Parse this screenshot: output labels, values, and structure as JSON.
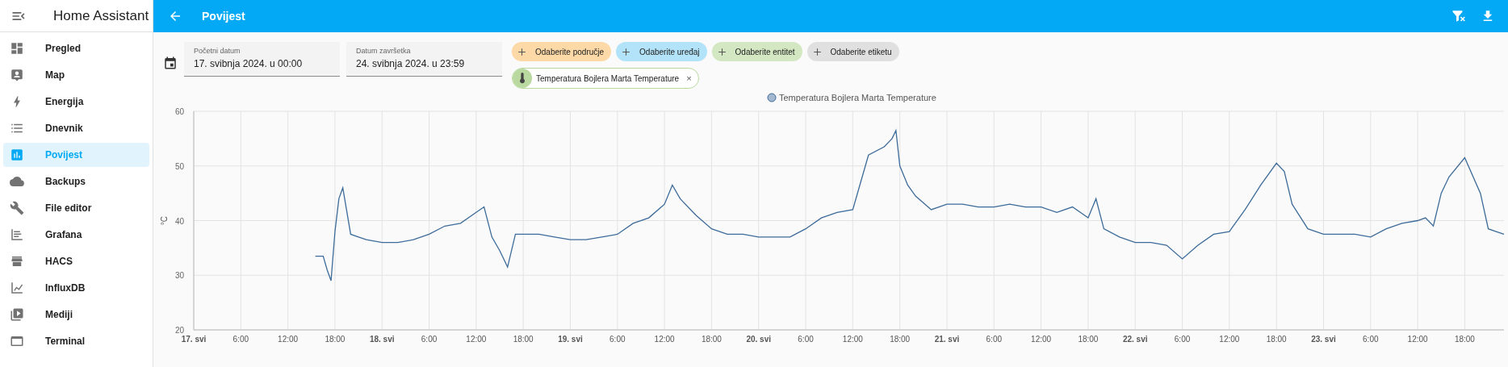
{
  "sidebar": {
    "title": "Home Assistant",
    "items": [
      {
        "label": "Pregled",
        "selected": false
      },
      {
        "label": "Map",
        "selected": false
      },
      {
        "label": "Energija",
        "selected": false
      },
      {
        "label": "Dnevnik",
        "selected": false
      },
      {
        "label": "Povijest",
        "selected": true
      },
      {
        "label": "Backups",
        "selected": false
      },
      {
        "label": "File editor",
        "selected": false
      },
      {
        "label": "Grafana",
        "selected": false
      },
      {
        "label": "HACS",
        "selected": false
      },
      {
        "label": "InfluxDB",
        "selected": false
      },
      {
        "label": "Mediji",
        "selected": false
      },
      {
        "label": "Terminal",
        "selected": false
      }
    ]
  },
  "toolbar": {
    "title": "Povijest"
  },
  "date_range": {
    "start": {
      "label": "Početni datum",
      "value": "17. svibnja 2024. u 00:00"
    },
    "end": {
      "label": "Datum završetka",
      "value": "24. svibnja 2024. u 23:59"
    }
  },
  "pickers": [
    {
      "label": "Odaberite područje",
      "color": "#fcd9a6"
    },
    {
      "label": "Odaberite uređaj",
      "color": "#b3e3f8"
    },
    {
      "label": "Odaberite entitet",
      "color": "#d3e8c2"
    },
    {
      "label": "Odaberite etiketu",
      "color": "#e0e0e0"
    }
  ],
  "selected_entities": [
    {
      "label": "Temperatura Bojlera Marta Temperature",
      "close": "×"
    }
  ],
  "chart": {
    "chart_data": {
      "type": "line",
      "grid": true,
      "ylabel": "°C",
      "xlim": [
        "2024-05-17 00:00",
        "2024-05-23 23:00"
      ],
      "ylim": [
        20,
        60
      ],
      "yticks": [
        20,
        30,
        40,
        50,
        60
      ],
      "xticks": [
        {
          "value": "2024-05-17 00:00",
          "label": "17. svi"
        },
        {
          "value": "2024-05-17 06:00",
          "label": "6:00"
        },
        {
          "value": "2024-05-17 12:00",
          "label": "12:00"
        },
        {
          "value": "2024-05-17 18:00",
          "label": "18:00"
        },
        {
          "value": "2024-05-18 00:00",
          "label": "18. svi"
        },
        {
          "value": "2024-05-18 06:00",
          "label": "6:00"
        },
        {
          "value": "2024-05-18 12:00",
          "label": "12:00"
        },
        {
          "value": "2024-05-18 18:00",
          "label": "18:00"
        },
        {
          "value": "2024-05-19 00:00",
          "label": "19. svi"
        },
        {
          "value": "2024-05-19 06:00",
          "label": "6:00"
        },
        {
          "value": "2024-05-19 12:00",
          "label": "12:00"
        },
        {
          "value": "2024-05-19 18:00",
          "label": "18:00"
        },
        {
          "value": "2024-05-20 00:00",
          "label": "20. svi"
        },
        {
          "value": "2024-05-20 06:00",
          "label": "6:00"
        },
        {
          "value": "2024-05-20 12:00",
          "label": "12:00"
        },
        {
          "value": "2024-05-20 18:00",
          "label": "18:00"
        },
        {
          "value": "2024-05-21 00:00",
          "label": "21. svi"
        },
        {
          "value": "2024-05-21 06:00",
          "label": "6:00"
        },
        {
          "value": "2024-05-21 12:00",
          "label": "12:00"
        },
        {
          "value": "2024-05-21 18:00",
          "label": "18:00"
        },
        {
          "value": "2024-05-22 00:00",
          "label": "22. svi"
        },
        {
          "value": "2024-05-22 06:00",
          "label": "6:00"
        },
        {
          "value": "2024-05-22 12:00",
          "label": "12:00"
        },
        {
          "value": "2024-05-22 18:00",
          "label": "18:00"
        },
        {
          "value": "2024-05-23 00:00",
          "label": "23. svi"
        },
        {
          "value": "2024-05-23 06:00",
          "label": "6:00"
        },
        {
          "value": "2024-05-23 12:00",
          "label": "12:00"
        },
        {
          "value": "2024-05-23 18:00",
          "label": "18:00"
        }
      ],
      "x": [
        "2024-05-17 15:30",
        "2024-05-17 16:30",
        "2024-05-17 17:00",
        "2024-05-17 17:30",
        "2024-05-17 18:00",
        "2024-05-17 18:30",
        "2024-05-17 19:00",
        "2024-05-17 20:00",
        "2024-05-17 21:00",
        "2024-05-17 22:00",
        "2024-05-18 00:00",
        "2024-05-18 02:00",
        "2024-05-18 04:00",
        "2024-05-18 06:00",
        "2024-05-18 08:00",
        "2024-05-18 10:00",
        "2024-05-18 12:00",
        "2024-05-18 13:00",
        "2024-05-18 14:00",
        "2024-05-18 15:00",
        "2024-05-18 16:00",
        "2024-05-18 17:00",
        "2024-05-18 18:00",
        "2024-05-18 20:00",
        "2024-05-18 22:00",
        "2024-05-19 00:00",
        "2024-05-19 02:00",
        "2024-05-19 04:00",
        "2024-05-19 06:00",
        "2024-05-19 08:00",
        "2024-05-19 10:00",
        "2024-05-19 12:00",
        "2024-05-19 13:00",
        "2024-05-19 14:00",
        "2024-05-19 16:00",
        "2024-05-19 18:00",
        "2024-05-19 20:00",
        "2024-05-19 22:00",
        "2024-05-20 00:00",
        "2024-05-20 02:00",
        "2024-05-20 04:00",
        "2024-05-20 06:00",
        "2024-05-20 08:00",
        "2024-05-20 10:00",
        "2024-05-20 12:00",
        "2024-05-20 14:00",
        "2024-05-20 16:00",
        "2024-05-20 17:00",
        "2024-05-20 17:30",
        "2024-05-20 18:00",
        "2024-05-20 19:00",
        "2024-05-20 20:00",
        "2024-05-20 22:00",
        "2024-05-21 00:00",
        "2024-05-21 02:00",
        "2024-05-21 04:00",
        "2024-05-21 06:00",
        "2024-05-21 08:00",
        "2024-05-21 10:00",
        "2024-05-21 12:00",
        "2024-05-21 14:00",
        "2024-05-21 16:00",
        "2024-05-21 18:00",
        "2024-05-21 19:00",
        "2024-05-21 20:00",
        "2024-05-21 22:00",
        "2024-05-22 00:00",
        "2024-05-22 02:00",
        "2024-05-22 04:00",
        "2024-05-22 06:00",
        "2024-05-22 08:00",
        "2024-05-22 10:00",
        "2024-05-22 12:00",
        "2024-05-22 14:00",
        "2024-05-22 16:00",
        "2024-05-22 18:00",
        "2024-05-22 19:00",
        "2024-05-22 20:00",
        "2024-05-22 22:00",
        "2024-05-23 00:00",
        "2024-05-23 02:00",
        "2024-05-23 04:00",
        "2024-05-23 06:00",
        "2024-05-23 08:00",
        "2024-05-23 10:00",
        "2024-05-23 12:00",
        "2024-05-23 13:00",
        "2024-05-23 14:00",
        "2024-05-23 15:00",
        "2024-05-23 16:00",
        "2024-05-23 18:00",
        "2024-05-23 20:00",
        "2024-05-23 21:00",
        "2024-05-23 22:00",
        "2024-05-23 23:00"
      ],
      "series": [
        {
          "name": "Temperatura Bojlera Marta Temperature",
          "color": "#3d6b99",
          "values": [
            33.5,
            33.5,
            31,
            29,
            38,
            44,
            46,
            37.5,
            37,
            36.5,
            36,
            36,
            36.5,
            37.5,
            39,
            39.5,
            41.5,
            42.5,
            37,
            34.5,
            31.5,
            37.5,
            37.5,
            37.5,
            37,
            36.5,
            36.5,
            37,
            37.5,
            39.5,
            40.5,
            43,
            46.5,
            44,
            41,
            38.5,
            37.5,
            37.5,
            37,
            37,
            37,
            38.5,
            40.5,
            41.5,
            42,
            52,
            53.5,
            55,
            56.5,
            50,
            46.5,
            44.5,
            42,
            43,
            43,
            42.5,
            42.5,
            43,
            42.5,
            42.5,
            41.5,
            42.5,
            40.5,
            44,
            38.5,
            37,
            36,
            36,
            35.5,
            33,
            35.5,
            37.5,
            38,
            42,
            46.5,
            50.5,
            49,
            43,
            38.5,
            37.5,
            37.5,
            37.5,
            37,
            38.5,
            39.5,
            40,
            40.5,
            39,
            45,
            48,
            51.5,
            45,
            38.5,
            38,
            37.5
          ]
        }
      ]
    }
  }
}
